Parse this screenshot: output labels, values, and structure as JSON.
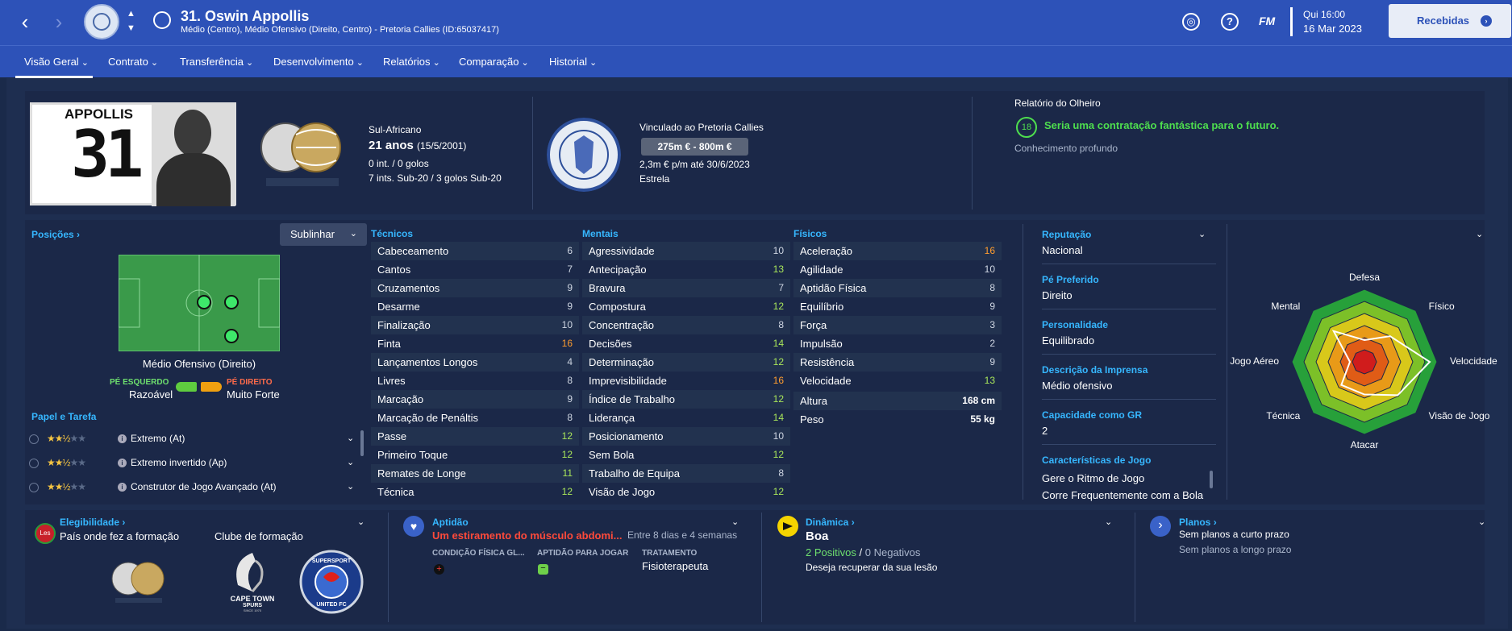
{
  "topbar": {
    "player_title": "31. Oswin Appollis",
    "positions_line": "Médio (Centro), Médio Ofensivo (Direito, Centro) - Pretoria Callies (ID:65037417)",
    "fm_label": "FM",
    "date_day": "Qui 16:00",
    "date_full": "16 Mar 2023",
    "inbox_label": "Recebidas"
  },
  "tabs": [
    "Visão Geral",
    "Contrato",
    "Transferência",
    "Desenvolvimento",
    "Relatórios",
    "Comparação",
    "Historial"
  ],
  "header": {
    "shirt_name": "APPOLLIS",
    "shirt_number": "31",
    "nationality": "Sul-Africano",
    "age": "21 anos",
    "birth": "(15/5/2001)",
    "caps": "0 int. / 0 golos",
    "youth_caps": "7 ints. Sub-20 / 3 golos Sub-20",
    "club_line": "Vinculado ao Pretoria Callies",
    "value": "275m € - 800m €",
    "wage": "2,3m € p/m até 30/6/2023",
    "status": "Estrela",
    "scout_title": "Relatório do Olheiro",
    "scout_score": "18",
    "scout_text": "Seria uma contratação fantástica para o futuro.",
    "scout_knowledge": "Conhecimento profundo"
  },
  "positions": {
    "title": "Posições",
    "highlight_label": "Sublinhar",
    "position_name": "Médio Ofensivo (Direito)",
    "left_foot_label": "PÉ ESQUERDO",
    "left_foot_value": "Razoável",
    "right_foot_label": "PÉ DIREITO",
    "right_foot_value": "Muito Forte",
    "roles_title": "Papel e Tarefa",
    "roles": [
      {
        "name": "Extremo (At)",
        "stars": 2.5
      },
      {
        "name": "Extremo invertido (Ap)",
        "stars": 2.5
      },
      {
        "name": "Construtor de Jogo Avançado (At)",
        "stars": 2.5
      }
    ]
  },
  "technical": {
    "title": "Técnicos",
    "items": [
      {
        "name": "Cabeceamento",
        "value": "6",
        "c": "w"
      },
      {
        "name": "Cantos",
        "value": "7",
        "c": "w"
      },
      {
        "name": "Cruzamentos",
        "value": "9",
        "c": "w"
      },
      {
        "name": "Desarme",
        "value": "9",
        "c": "w"
      },
      {
        "name": "Finalização",
        "value": "10",
        "c": "w"
      },
      {
        "name": "Finta",
        "value": "16",
        "c": "o"
      },
      {
        "name": "Lançamentos Longos",
        "value": "4",
        "c": "w"
      },
      {
        "name": "Livres",
        "value": "8",
        "c": "w"
      },
      {
        "name": "Marcação",
        "value": "9",
        "c": "w"
      },
      {
        "name": "Marcação de Penáltis",
        "value": "8",
        "c": "w"
      },
      {
        "name": "Passe",
        "value": "12",
        "c": "g"
      },
      {
        "name": "Primeiro Toque",
        "value": "12",
        "c": "g"
      },
      {
        "name": "Remates de Longe",
        "value": "11",
        "c": "g"
      },
      {
        "name": "Técnica",
        "value": "12",
        "c": "g"
      }
    ]
  },
  "mental": {
    "title": "Mentais",
    "items": [
      {
        "name": "Agressividade",
        "value": "10",
        "c": "w"
      },
      {
        "name": "Antecipação",
        "value": "13",
        "c": "g"
      },
      {
        "name": "Bravura",
        "value": "7",
        "c": "w"
      },
      {
        "name": "Compostura",
        "value": "12",
        "c": "g"
      },
      {
        "name": "Concentração",
        "value": "8",
        "c": "w"
      },
      {
        "name": "Decisões",
        "value": "14",
        "c": "g"
      },
      {
        "name": "Determinação",
        "value": "12",
        "c": "g"
      },
      {
        "name": "Imprevisibilidade",
        "value": "16",
        "c": "o"
      },
      {
        "name": "Índice de Trabalho",
        "value": "12",
        "c": "g"
      },
      {
        "name": "Liderança",
        "value": "14",
        "c": "g"
      },
      {
        "name": "Posicionamento",
        "value": "10",
        "c": "w"
      },
      {
        "name": "Sem Bola",
        "value": "12",
        "c": "g"
      },
      {
        "name": "Trabalho de Equipa",
        "value": "8",
        "c": "w"
      },
      {
        "name": "Visão de Jogo",
        "value": "12",
        "c": "g"
      }
    ]
  },
  "physical": {
    "title": "Físicos",
    "items": [
      {
        "name": "Aceleração",
        "value": "16",
        "c": "o"
      },
      {
        "name": "Agilidade",
        "value": "10",
        "c": "w"
      },
      {
        "name": "Aptidão Física",
        "value": "8",
        "c": "w"
      },
      {
        "name": "Equilíbrio",
        "value": "9",
        "c": "w"
      },
      {
        "name": "Força",
        "value": "3",
        "c": "w"
      },
      {
        "name": "Impulsão",
        "value": "2",
        "c": "w"
      },
      {
        "name": "Resistência",
        "value": "9",
        "c": "w"
      },
      {
        "name": "Velocidade",
        "value": "13",
        "c": "g"
      }
    ],
    "height_label": "Altura",
    "height_value": "168 cm",
    "weight_label": "Peso",
    "weight_value": "55 kg"
  },
  "info": {
    "reputation_label": "Reputação",
    "reputation_value": "Nacional",
    "foot_label": "Pé Preferido",
    "foot_value": "Direito",
    "personality_label": "Personalidade",
    "personality_value": "Equilibrado",
    "media_label": "Descrição da Imprensa",
    "media_value": "Médio ofensivo",
    "gk_label": "Capacidade como GR",
    "gk_value": "2",
    "traits_label": "Características de Jogo",
    "traits": [
      "Gere o Ritmo de Jogo",
      "Corre Frequentemente com a Bola"
    ]
  },
  "radar": {
    "labels": [
      "Defesa",
      "Físico",
      "Velocidade",
      "Visão de Jogo",
      "Atacar",
      "Técnica",
      "Jogo Aéreo",
      "Mental"
    ],
    "values": [
      0.3,
      0.5,
      0.9,
      0.65,
      0.45,
      0.45,
      0.2,
      0.6
    ],
    "colors": [
      "#27a03a",
      "#7cc028",
      "#d8c81a",
      "#e89a18",
      "#e05c16",
      "#d01c1c"
    ]
  },
  "bottom": {
    "elig_title": "Elegibilidade",
    "elig_badge": "Les",
    "elig_text": "País onde fez a formação",
    "youth_club_label": "Clube de formação",
    "cape_town_name": "CAPE TOWN",
    "cape_town_name2": "SPURS",
    "cape_town_since": "SINCE 1970",
    "ssu_name": "SUPERSPORT",
    "ssu_name2": "UNITED FC",
    "fitness_title": "Aptidão",
    "injury": "Um estiramento do músculo abdomi...",
    "injury_duration": "Entre 8 dias e 4 semanas",
    "col_condition": "CONDIÇÃO FÍSICA GL...",
    "col_fitness": "APTIDÃO PARA JOGAR",
    "col_treatment": "TRATAMENTO",
    "treatment_value": "Fisioterapeuta",
    "dynamic_title": "Dinâmica",
    "dynamic_value": "Boa",
    "positives": "2 Positivos",
    "slash": "/",
    "negatives": "0 Negativos",
    "dynamic_note": "Deseja recuperar da sua lesão",
    "plans_title": "Planos",
    "plans_short": "Sem planos a curto prazo",
    "plans_long": "Sem planos a longo prazo"
  }
}
